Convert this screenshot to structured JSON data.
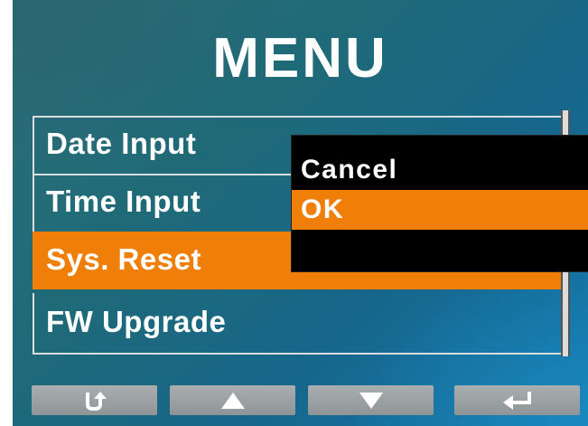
{
  "title": "MENU",
  "menu": {
    "items": [
      {
        "label": "Date Input",
        "selected": false
      },
      {
        "label": "Time Input",
        "selected": false
      },
      {
        "label": "Sys. Reset",
        "selected": true
      },
      {
        "label": "FW Upgrade",
        "selected": false
      }
    ]
  },
  "popup": {
    "options": [
      {
        "label": "Cancel",
        "selected": false
      },
      {
        "label": "OK",
        "selected": true
      }
    ]
  },
  "softkeys": [
    {
      "icon": "return-icon"
    },
    {
      "icon": "up-arrow-icon"
    },
    {
      "icon": "down-arrow-icon"
    },
    {
      "icon": "enter-icon"
    }
  ],
  "colors": {
    "highlight": "#f07f0a",
    "background": "#1f6a78",
    "popup": "#000000",
    "text": "#ffffff",
    "softkey": "#9da2a5"
  }
}
